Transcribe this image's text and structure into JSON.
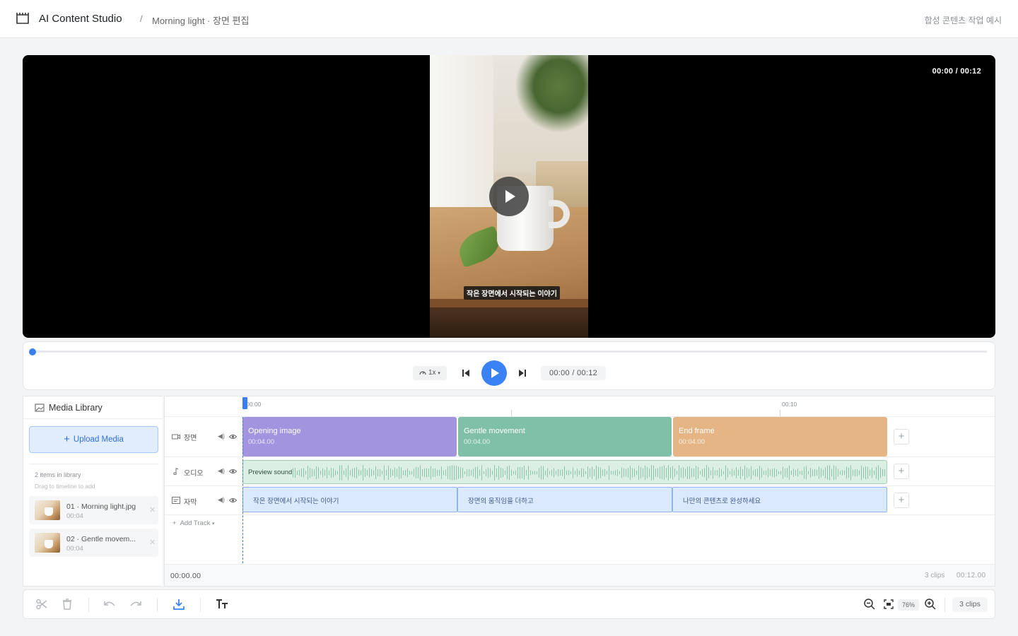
{
  "header": {
    "app_title": "AI Content Studio",
    "breadcrumb_sep": "/",
    "breadcrumb": "Morning light · 장면 편집",
    "note": "합성 콘텐츠 작업 예시"
  },
  "preview": {
    "timecode": "00:00 / 00:12",
    "subtitle": "작은 장면에서 시작되는 이야기",
    "play_icon": "play-icon"
  },
  "player": {
    "progress": 0,
    "speed": "1x",
    "time": "00:00 / 00:12",
    "icons": [
      "speed-icon",
      "skip-back-icon",
      "play-icon",
      "skip-forward-icon"
    ]
  },
  "library": {
    "title": "Media Library",
    "upload_label": "Upload Media",
    "count": "2 items in library",
    "hint": "Drag to timeline to add",
    "items": [
      {
        "name": "01 · Morning light.jpg",
        "duration": "00:04"
      },
      {
        "name": "02 · Gentle movem...",
        "duration": "00:04"
      }
    ]
  },
  "timeline": {
    "ruler": [
      "00:00",
      "00:10"
    ],
    "tracks": {
      "scene": {
        "label": "장면"
      },
      "audio": {
        "label": "오디오"
      },
      "subtitle": {
        "label": "자막"
      }
    },
    "scene_clips": [
      {
        "title": "Opening image",
        "duration": "00:04.00",
        "color": "#a394e0"
      },
      {
        "title": "Gentle movement",
        "duration": "00:04.00",
        "color": "#80c0a8"
      },
      {
        "title": "End frame",
        "duration": "00:04.00",
        "color": "#e5b585"
      }
    ],
    "audio_clip": {
      "label": "Preview sound"
    },
    "subtitle_clips": [
      {
        "text": "작은 장면에서 시작되는 이야기"
      },
      {
        "text": "장면의 움직임을 더하고"
      },
      {
        "text": "나만의 콘텐츠로 완성하세요"
      }
    ],
    "add_track": "Add Track",
    "footer": {
      "time": "00:00.00",
      "clips": "3 clips",
      "total": "00:12.00"
    }
  },
  "toolbar": {
    "zoom": "76%",
    "clips": "3 clips",
    "icons": [
      "scissors-icon",
      "trash-icon",
      "undo-icon",
      "redo-icon",
      "download-icon",
      "text-icon",
      "zoom-out-icon",
      "fit-icon",
      "zoom-in-icon"
    ],
    "accent": "#3b82f6"
  }
}
